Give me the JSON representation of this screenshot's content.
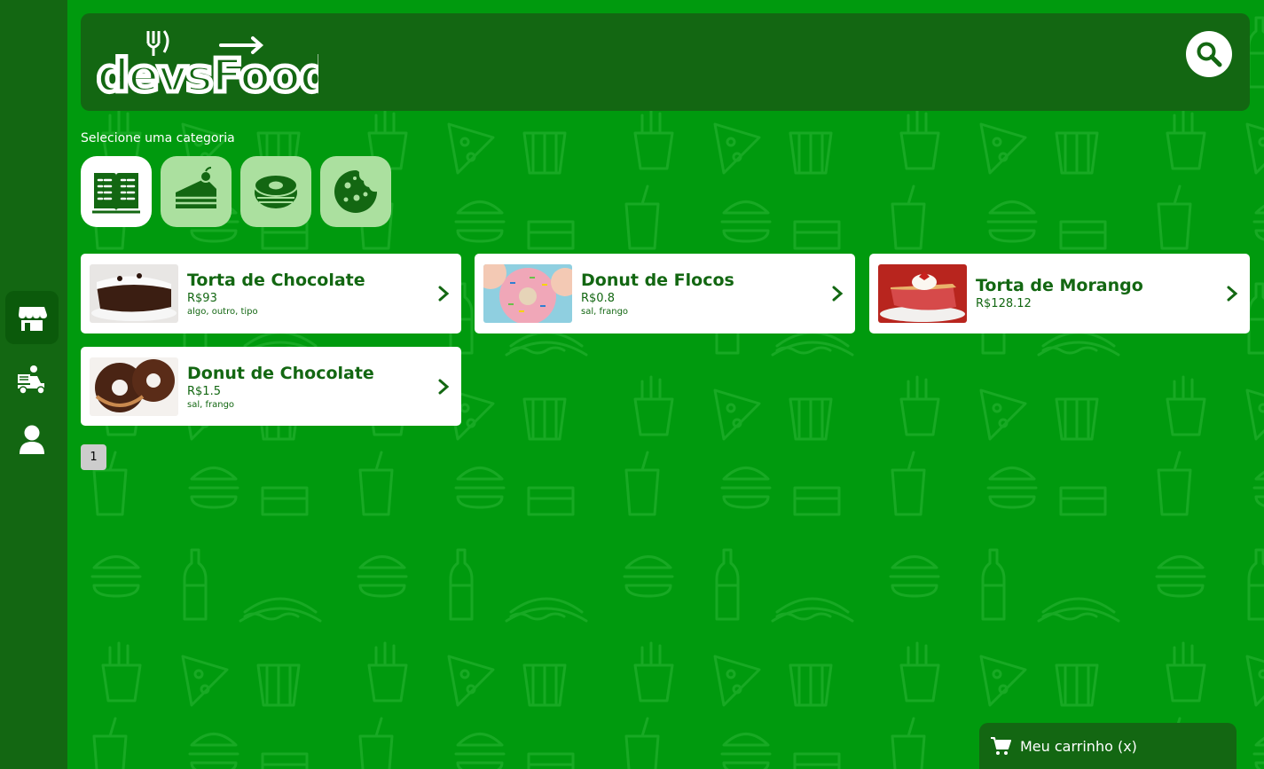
{
  "colors": {
    "background": "#009a0e",
    "dark_green": "#136712",
    "category_bg": "#abe09f"
  },
  "header": {
    "logo_text": "devsFood"
  },
  "categories": {
    "title": "Selecione uma categoria",
    "items": [
      {
        "icon": "menu-book-icon",
        "active": true
      },
      {
        "icon": "cake-icon",
        "active": false
      },
      {
        "icon": "donut-icon",
        "active": false
      },
      {
        "icon": "cookie-icon",
        "active": false
      }
    ]
  },
  "products": [
    {
      "name": "Torta de Chocolate",
      "price": "R$93",
      "ingredients": "algo, outro, tipo",
      "image": "chocolate-pie-photo"
    },
    {
      "name": "Donut de Flocos",
      "price": "R$0.8",
      "ingredients": "sal, frango",
      "image": "sprinkle-donut-photo"
    },
    {
      "name": "Torta de Morango",
      "price": "R$128.12",
      "ingredients": "",
      "image": "strawberry-pie-photo"
    },
    {
      "name": "Donut de Chocolate",
      "price": "R$1.5",
      "ingredients": "sal, frango",
      "image": "chocolate-donut-photo"
    }
  ],
  "pagination": {
    "current": "1"
  },
  "cart": {
    "label": "Meu carrinho (x)"
  },
  "sidebar": {
    "items": [
      {
        "icon": "store-icon",
        "active": true
      },
      {
        "icon": "delivery-icon",
        "active": false
      },
      {
        "icon": "user-icon",
        "active": false
      }
    ]
  }
}
